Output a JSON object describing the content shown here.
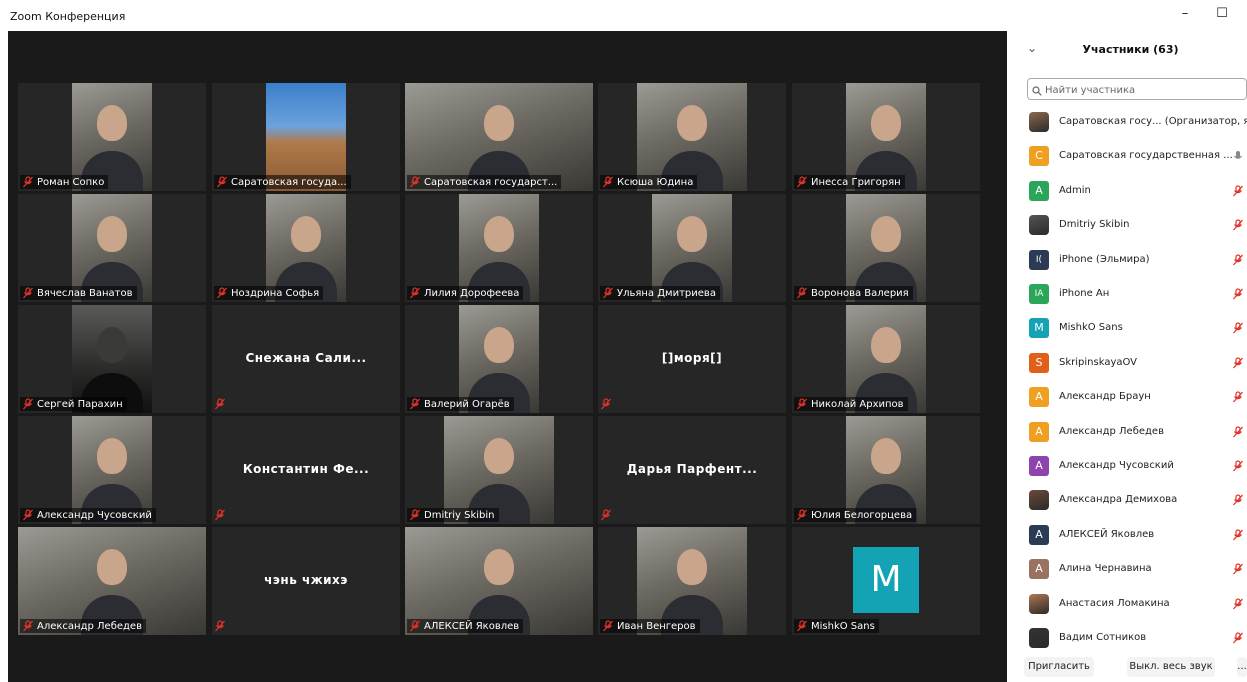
{
  "window": {
    "title": "Zoom Конференция",
    "minimize": "–",
    "maximize": "☐"
  },
  "tiles": [
    {
      "name": "Роман Сопко",
      "type": "video",
      "video": "narrow",
      "active": false
    },
    {
      "name": "Саратовская госуда...",
      "type": "video",
      "video": "narrow",
      "active": false,
      "scene": "building"
    },
    {
      "name": "Саратовская государст...",
      "type": "video",
      "video": "wide",
      "active": true
    },
    {
      "name": "Ксюша Юдина",
      "type": "video",
      "video": "mid",
      "active": false
    },
    {
      "name": "Инесса Григорян",
      "type": "video",
      "video": "narrow",
      "active": false
    },
    {
      "name": "Вячеслав Ванатов",
      "type": "video",
      "video": "narrow",
      "active": false
    },
    {
      "name": "Ноздрина Софья",
      "type": "video",
      "video": "narrow",
      "active": false
    },
    {
      "name": "Лилия Дорофеева",
      "type": "video",
      "video": "narrow",
      "active": false
    },
    {
      "name": "Ульяна Дмитриева",
      "type": "video",
      "video": "narrow",
      "active": false
    },
    {
      "name": "Воронова Валерия",
      "type": "video",
      "video": "narrow",
      "active": false
    },
    {
      "name": "Сергей Парахин",
      "type": "video",
      "video": "narrow",
      "active": false,
      "dark": true
    },
    {
      "name": "",
      "big": "Снежана  Сали...",
      "type": "noVideo",
      "active": false
    },
    {
      "name": "Валерий Огарёв",
      "type": "video",
      "video": "narrow",
      "active": false
    },
    {
      "name": "",
      "big": "[]моря[]",
      "type": "noVideo",
      "active": false
    },
    {
      "name": "Николай Архипов",
      "type": "video",
      "video": "narrow",
      "active": false
    },
    {
      "name": "Александр Чусовский",
      "type": "video",
      "video": "narrow",
      "active": false
    },
    {
      "name": "",
      "big": "Константин  Фе...",
      "type": "noVideo",
      "active": false
    },
    {
      "name": "Dmitriy Skibin",
      "type": "video",
      "video": "mid",
      "active": false
    },
    {
      "name": "",
      "big": "Дарья  Парфент...",
      "type": "noVideo",
      "active": false
    },
    {
      "name": "Юлия Белогорцева",
      "type": "video",
      "video": "narrow",
      "active": false
    },
    {
      "name": "Александр Лебедев",
      "type": "video",
      "video": "wide",
      "active": false
    },
    {
      "name": "",
      "big": "чэнь чжихэ",
      "type": "noVideo",
      "active": false
    },
    {
      "name": "АЛЕКСЕЙ Яковлев",
      "type": "video",
      "video": "wide",
      "active": false
    },
    {
      "name": "Иван Венгеров",
      "type": "video",
      "video": "mid",
      "active": false
    },
    {
      "name": "MishkO Sans",
      "type": "avatar",
      "letter": "M",
      "active": false
    }
  ],
  "panel": {
    "title": "Участники (63)",
    "collapse_icon": "chevron-down-icon",
    "search_placeholder": "Найти участника",
    "participants": [
      {
        "name": "Саратовская госу... (Организатор, я)",
        "avatar": "photo",
        "color": "#8a6a4f",
        "mic": "none"
      },
      {
        "name": "Саратовская государственная ...",
        "avatar": "C",
        "color": "#f0a020",
        "mic": "on"
      },
      {
        "name": "Admin",
        "avatar": "A",
        "color": "#2aa55a",
        "mic": "muted"
      },
      {
        "name": "Dmitriy Skibin",
        "avatar": "photo",
        "color": "#555555",
        "mic": "muted"
      },
      {
        "name": "iPhone (Эльмира)",
        "avatar": "I(",
        "color": "#2b3a55",
        "mic": "muted"
      },
      {
        "name": "iPhone Ан",
        "avatar": "IA",
        "color": "#2aa55a",
        "mic": "muted"
      },
      {
        "name": "MishkO Sans",
        "avatar": "M",
        "color": "#14a3b4",
        "mic": "muted"
      },
      {
        "name": "SkripinskayaOV",
        "avatar": "S",
        "color": "#e0601a",
        "mic": "muted"
      },
      {
        "name": "Александр Браун",
        "avatar": "A",
        "color": "#f0a020",
        "mic": "muted"
      },
      {
        "name": "Александр Лебедев",
        "avatar": "A",
        "color": "#f0a020",
        "mic": "muted"
      },
      {
        "name": "Александр Чусовский",
        "avatar": "A",
        "color": "#8e44ad",
        "mic": "muted"
      },
      {
        "name": "Александра Демихова",
        "avatar": "photo",
        "color": "#6b4a3a",
        "mic": "muted"
      },
      {
        "name": "АЛЕКСЕЙ Яковлев",
        "avatar": "A",
        "color": "#2b3a55",
        "mic": "muted"
      },
      {
        "name": "Алина Чернавина",
        "avatar": "A",
        "color": "#9a7260",
        "mic": "muted"
      },
      {
        "name": "Анастасия Ломакина",
        "avatar": "photo",
        "color": "#b07850",
        "mic": "muted"
      },
      {
        "name": "Вадим Сотников",
        "avatar": "photo",
        "color": "#333333",
        "mic": "muted"
      }
    ],
    "invite": "Пригласить",
    "mute_all": "Выкл. весь звук",
    "more": "..."
  },
  "colors": {
    "video_bg": "#1a1a1a",
    "tile_bg": "#262626",
    "active_speaker": "#c6e24b",
    "muted_red": "#e0322a"
  }
}
